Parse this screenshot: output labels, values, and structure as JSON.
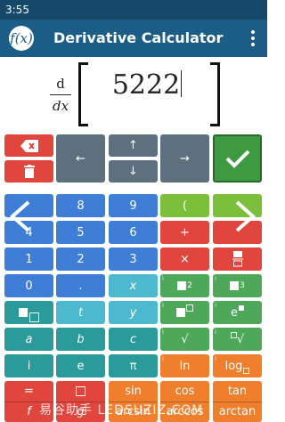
{
  "status_bar": {
    "time": "3:55"
  },
  "app_bar": {
    "title": "Derivative Calculator",
    "logo_text": "f(x)"
  },
  "display": {
    "operator_top": "d",
    "operator_bottom": "dx",
    "expression": "5222"
  },
  "keys": {
    "row1": [
      "←",
      "↑",
      "→"
    ],
    "row2": [
      "↓"
    ],
    "r3": [
      "8",
      "9",
      "("
    ],
    "r4": [
      "4",
      "5",
      "6",
      "+"
    ],
    "r5": [
      "1",
      "2",
      "3",
      "×"
    ],
    "r6": [
      "0",
      ".",
      "x"
    ],
    "r7": [
      "t",
      "y"
    ],
    "r8": [
      "a",
      "b",
      "c"
    ],
    "r9": [
      "i",
      "e",
      "π",
      "ln",
      "log"
    ],
    "r10_top": [
      "sin",
      "cos",
      "tan"
    ],
    "r10_bot": [
      "f",
      "g",
      "arcsin",
      "arccos",
      "arctan"
    ],
    "sqrt": "√",
    "sup2": "2",
    "sup3": "3",
    "e_base": "e"
  },
  "watermark": "易谷助手 LEDSUZIZ.COM",
  "colors": {
    "app_bar": "#1b5d86",
    "status_bar": "#154869",
    "accent_green": "#3e9a41",
    "delete_red": "#e0463e"
  }
}
